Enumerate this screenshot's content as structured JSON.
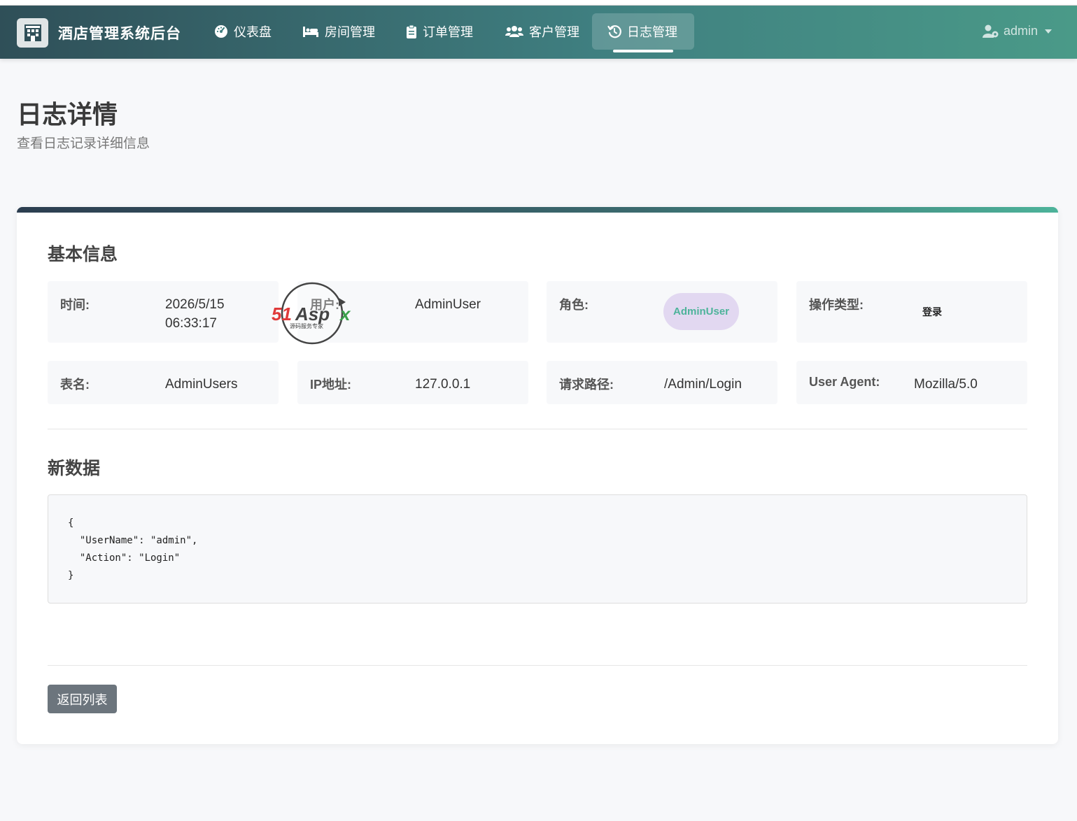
{
  "app": {
    "title": "酒店管理系统后台",
    "logo_icon": "hotel-building-icon"
  },
  "nav": {
    "items": [
      {
        "label": "仪表盘",
        "icon": "dashboard-gauge-icon"
      },
      {
        "label": "房间管理",
        "icon": "bed-icon"
      },
      {
        "label": "订单管理",
        "icon": "clipboard-icon"
      },
      {
        "label": "客户管理",
        "icon": "users-icon"
      },
      {
        "label": "日志管理",
        "icon": "history-icon",
        "active": true
      }
    ],
    "user": {
      "name": "admin",
      "icon": "user-gear-icon"
    }
  },
  "page": {
    "title": "日志详情",
    "subtitle": "查看日志记录详细信息"
  },
  "basic_info": {
    "section_title": "基本信息",
    "time": {
      "label": "时间:",
      "value_line1": "2026/5/15",
      "value_line2": "06:33:17"
    },
    "user": {
      "label": "用户:",
      "value": "AdminUser"
    },
    "role": {
      "label": "角色:",
      "value": "AdminUser"
    },
    "op_type": {
      "label": "操作类型:",
      "value": "登录"
    },
    "table": {
      "label": "表名:",
      "value": "AdminUsers"
    },
    "ip": {
      "label": "IP地址:",
      "value": "127.0.0.1"
    },
    "path": {
      "label": "请求路径:",
      "value": "/Admin/Login"
    },
    "user_agent": {
      "label": "User Agent:",
      "value": "Mozilla/5.0"
    }
  },
  "new_data": {
    "section_title": "新数据",
    "json_text": "{\n  \"UserName\": \"admin\",\n  \"Action\": \"Login\"\n}"
  },
  "actions": {
    "back_label": "返回列表"
  },
  "watermark": {
    "text": "51Aspx",
    "subtext": "源码服务专家"
  },
  "colors": {
    "accent": "#4db39a",
    "nav_dark": "#2f4f58",
    "role_badge_bg": "#e2d8f1",
    "button_gray": "#6c757d"
  }
}
